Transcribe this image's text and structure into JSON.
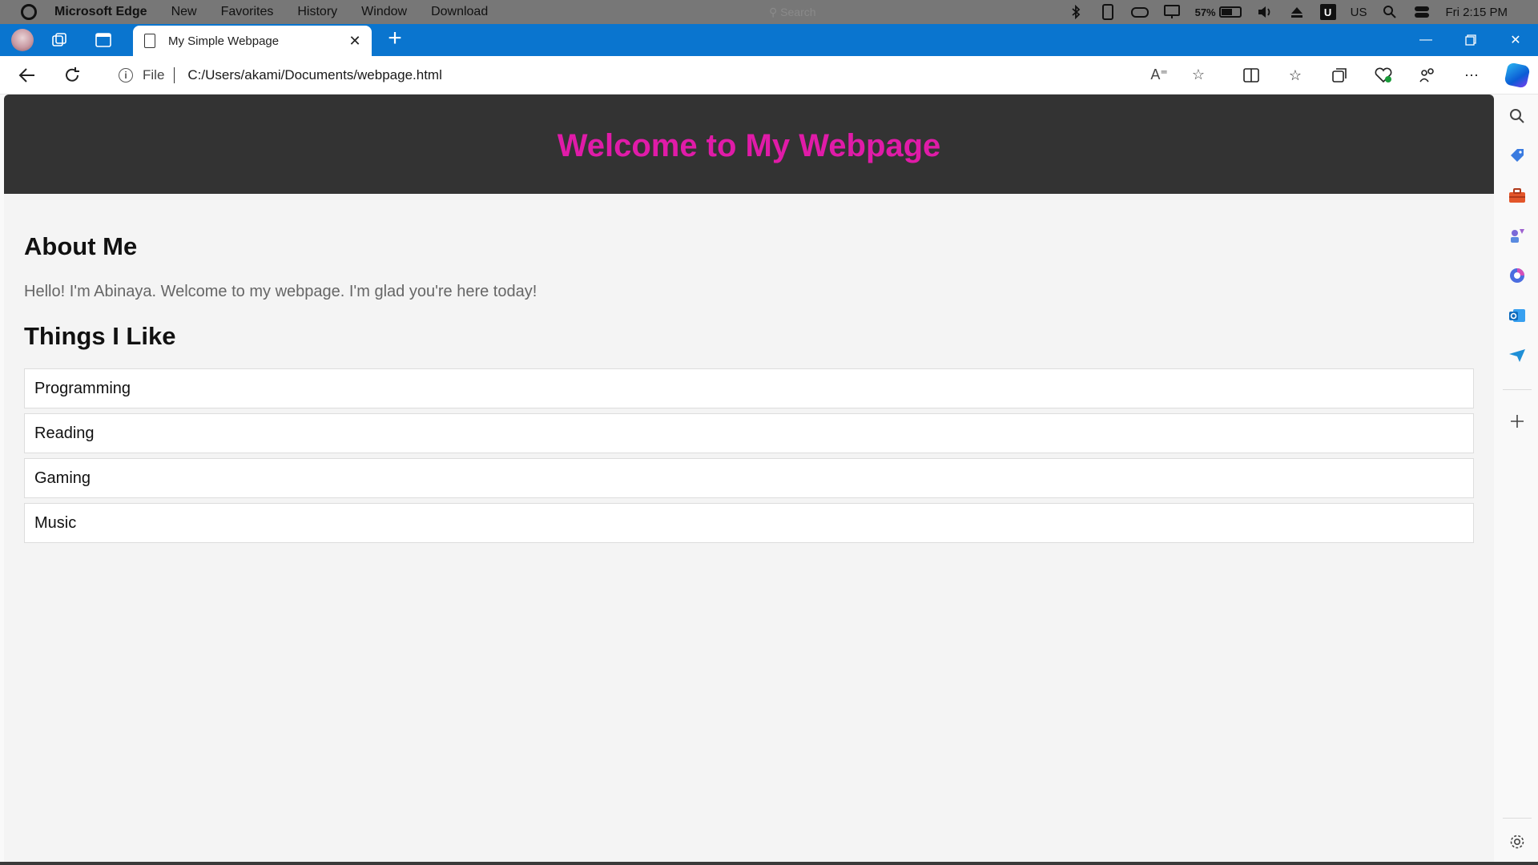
{
  "os": {
    "app_name": "Microsoft Edge",
    "menu": [
      "New",
      "Favorites",
      "History",
      "Window",
      "Download"
    ],
    "search_placeholder": "Search",
    "battery": "57%",
    "battery_level": 0.57,
    "input_language": "US",
    "clock": "Fri 2:15 PM"
  },
  "browser": {
    "tab_title": "My Simple Webpage",
    "address_scheme": "File",
    "address_url": "C:/Users/akami/Documents/webpage.html",
    "accent_color": "#0a75cf"
  },
  "page": {
    "header_title": "Welcome to My Webpage",
    "header_color": "#e01ba8",
    "about_heading": "About Me",
    "about_text": "Hello! I'm Abinaya. Welcome to my webpage. I'm glad you're here today!",
    "likes_heading": "Things I Like",
    "likes": [
      "Programming",
      "Reading",
      "Gaming",
      "Music"
    ]
  },
  "icons": {
    "toolbar": [
      "split-screen-icon",
      "favorites-icon",
      "collections-icon",
      "browser-essentials-icon",
      "share-icon",
      "more-icon"
    ],
    "sidebar": [
      "search-icon",
      "shopping-tag-icon",
      "tools-icon",
      "games-icon",
      "microsoft365-icon",
      "outlook-icon",
      "send-icon",
      "add-icon",
      "settings-icon"
    ]
  }
}
